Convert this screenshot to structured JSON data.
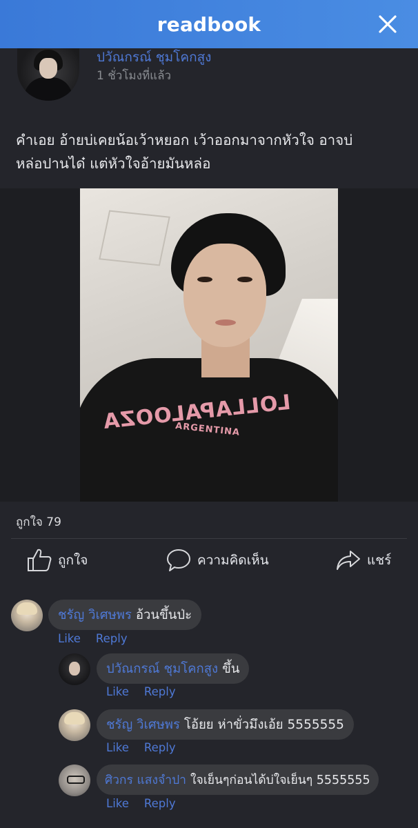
{
  "header": {
    "brand": "readbook"
  },
  "post": {
    "author_name": "ปวัณกรณ์ ชุมโคกสูง",
    "time": "1 ชั่วโมงที่แล้ว",
    "text_line1": "คำเอย อ้ายบ่เคยน้อเว้าหยอก เว้าออกมาจากหัวใจ อาจบ่",
    "text_line2": "หล่อปานได๋ แต่หัวใจอ้ายมันหล่อ",
    "photo_print": "LOLLAPALOOZA",
    "photo_print_sub": "ARGENTINA",
    "likes": "ถูกใจ 79"
  },
  "actions": {
    "like": "ถูกใจ",
    "comment": "ความคิดเห็น",
    "share": "แชร์"
  },
  "comments": [
    {
      "name": "ชรัญ วิเศษพร",
      "text": "อ้วนขึ้นป่ะ",
      "like": "Like",
      "reply": "Reply"
    },
    {
      "name": "ปวัณกรณ์ ชุมโคกสูง",
      "text": "ขึ้น",
      "like": "Like",
      "reply": "Reply"
    },
    {
      "name": "ชรัญ วิเศษพร",
      "text": "โอ้ยย ห่าขั่วมึงเอ้ย 5555555",
      "like": "Like",
      "reply": "Reply"
    },
    {
      "name": "ศิวกร แสงจำปา",
      "text": "ใจเย็นๆก่อนได้บ่ใจเย็นๆ 5555555",
      "like": "Like",
      "reply": "Reply"
    }
  ],
  "colors": {
    "header": "#3a79d8",
    "link": "#4f79d6",
    "background": "#24252b",
    "bubble": "#3a3b3f"
  },
  "icons": {
    "close": "close-icon",
    "like": "thumbs-up-icon",
    "comment": "speech-bubble-icon",
    "share": "share-arrow-icon"
  }
}
